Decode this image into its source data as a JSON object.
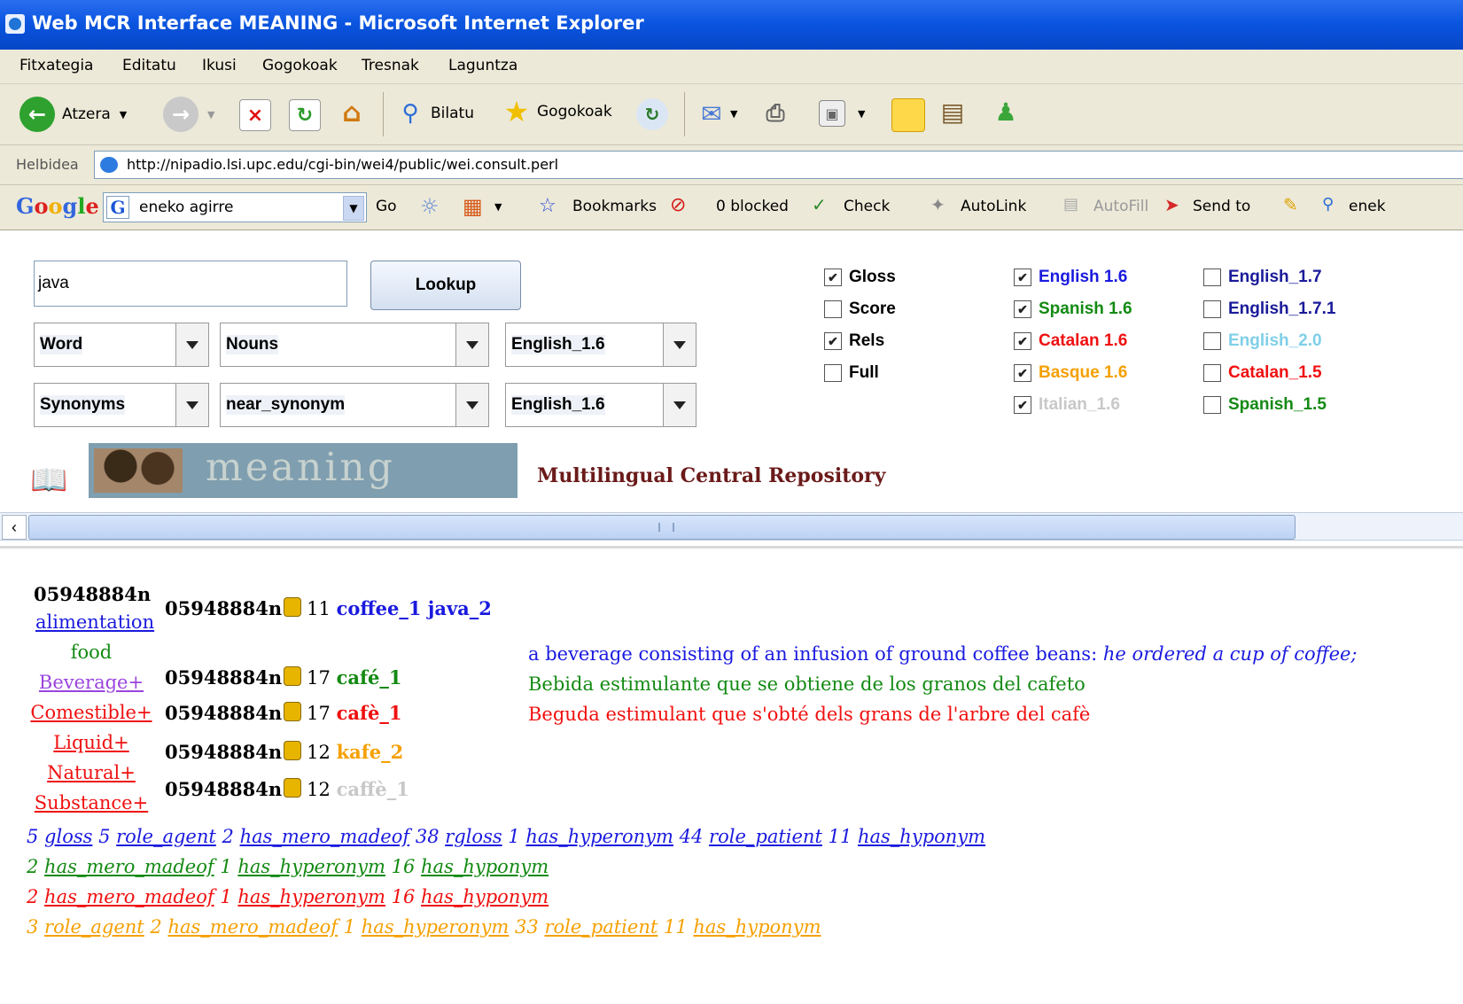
{
  "window": {
    "title": "Web MCR Interface MEANING - Microsoft Internet Explorer"
  },
  "menu": [
    "Fitxategia",
    "Editatu",
    "Ikusi",
    "Gogokoak",
    "Tresnak",
    "Laguntza"
  ],
  "toolbar": {
    "back_label": "Atzera",
    "search_label": "Bilatu",
    "favorites_label": "Gogokoak"
  },
  "address": {
    "label": "Helbidea",
    "url": "http://nipadio.lsi.upc.edu/cgi-bin/wei4/public/wei.consult.perl"
  },
  "google_bar": {
    "logo": "Google",
    "search_value": "eneko agirre",
    "go_label": "Go",
    "bookmarks_label": "Bookmarks",
    "blocked_label": "0 blocked",
    "check_label": "Check",
    "autolink_label": "AutoLink",
    "autofill_label": "AutoFill",
    "sendto_label": "Send to",
    "user_label": "enek"
  },
  "form": {
    "query": "java",
    "lookup_label": "Lookup",
    "dd1": "Word",
    "dd2": "Nouns",
    "dd3": "English_1.6",
    "dd4": "Synonyms",
    "dd5": "near_synonym",
    "dd6": "English_1.6"
  },
  "options": [
    {
      "label": "Gloss",
      "checked": true,
      "color": "#000000"
    },
    {
      "label": "Score",
      "checked": false,
      "color": "#000000"
    },
    {
      "label": "Rels",
      "checked": true,
      "color": "#000000"
    },
    {
      "label": "Full",
      "checked": false,
      "color": "#000000"
    }
  ],
  "languages_col1": [
    {
      "label": "English  1.6",
      "checked": true,
      "color": "#1a1adf"
    },
    {
      "label": "Spanish  1.6",
      "checked": true,
      "color": "#138a13"
    },
    {
      "label": "Catalan  1.6",
      "checked": true,
      "color": "#f01010"
    },
    {
      "label": "Basque  1.6",
      "checked": true,
      "color": "#f5a000"
    },
    {
      "label": "Italian_1.6",
      "checked": true,
      "color": "#c8c8c8"
    }
  ],
  "languages_col2": [
    {
      "label": "English_1.7",
      "checked": false,
      "color": "#1a1a9a"
    },
    {
      "label": "English_1.7.1",
      "checked": false,
      "color": "#1a1a9a"
    },
    {
      "label": "English_2.0",
      "checked": false,
      "color": "#7fcfe8"
    },
    {
      "label": "Catalan_1.5",
      "checked": false,
      "color": "#f01010"
    },
    {
      "label": "Spanish_1.5",
      "checked": false,
      "color": "#138a13"
    }
  ],
  "brand": {
    "logo_text": "meaning",
    "subtitle": "Multilingual Central Repository"
  },
  "results": {
    "synset_id": "05948884n",
    "domains": [
      {
        "label": "alimentation",
        "color": "#1a1adf",
        "link": true
      },
      {
        "label": "food",
        "color": "#138a13",
        "link": false
      },
      {
        "label": "Beverage+",
        "color": "#9a44dd",
        "link": true
      },
      {
        "label": "Comestible+",
        "color": "#f01010",
        "link": true
      },
      {
        "label": "Liquid+",
        "color": "#f01010",
        "link": true
      },
      {
        "label": "Natural+",
        "color": "#f01010",
        "link": true
      },
      {
        "label": "Substance+",
        "color": "#f01010",
        "link": true
      }
    ],
    "entries": [
      {
        "id": "05948884n",
        "score": "11",
        "words": "coffee_1 java_2",
        "color": "#1a1adf"
      },
      {
        "id": "05948884n",
        "score": "17",
        "words": "café_1",
        "color": "#138a13"
      },
      {
        "id": "05948884n",
        "score": "17",
        "words": "cafè_1",
        "color": "#f01010"
      },
      {
        "id": "05948884n",
        "score": "12",
        "words": "kafe_2",
        "color": "#f5a000"
      },
      {
        "id": "05948884n",
        "score": "12",
        "words": "caffè_1",
        "color": "#c8c8c8"
      }
    ],
    "glosses": [
      {
        "text": "a beverage consisting of an infusion of ground coffee beans: ",
        "example": "he ordered a cup of coffee;",
        "color": "#1a1adf"
      },
      {
        "text": "Bebida estimulante que se obtiene de los granos del cafeto",
        "example": "",
        "color": "#138a13"
      },
      {
        "text": "Beguda estimulant que s'obté dels grans de l'arbre del cafè",
        "example": "",
        "color": "#f01010"
      }
    ],
    "relation_lines": [
      {
        "color": "#1a1adf",
        "items": [
          [
            "5",
            "gloss"
          ],
          [
            "5",
            "role_agent"
          ],
          [
            "2",
            "has_mero_madeof"
          ],
          [
            "38",
            "rgloss"
          ],
          [
            "1",
            "has_hyperonym"
          ],
          [
            "44",
            "role_patient"
          ],
          [
            "11",
            "has_hyponym"
          ]
        ]
      },
      {
        "color": "#138a13",
        "items": [
          [
            "2",
            "has_mero_madeof"
          ],
          [
            "1",
            "has_hyperonym"
          ],
          [
            "16",
            "has_hyponym"
          ]
        ]
      },
      {
        "color": "#f01010",
        "items": [
          [
            "2",
            "has_mero_madeof"
          ],
          [
            "1",
            "has_hyperonym"
          ],
          [
            "16",
            "has_hyponym"
          ]
        ]
      },
      {
        "color": "#f5a000",
        "items": [
          [
            "3",
            "role_agent"
          ],
          [
            "2",
            "has_mero_madeof"
          ],
          [
            "1",
            "has_hyperonym"
          ],
          [
            "33",
            "role_patient"
          ],
          [
            "11",
            "has_hyponym"
          ]
        ]
      }
    ]
  }
}
